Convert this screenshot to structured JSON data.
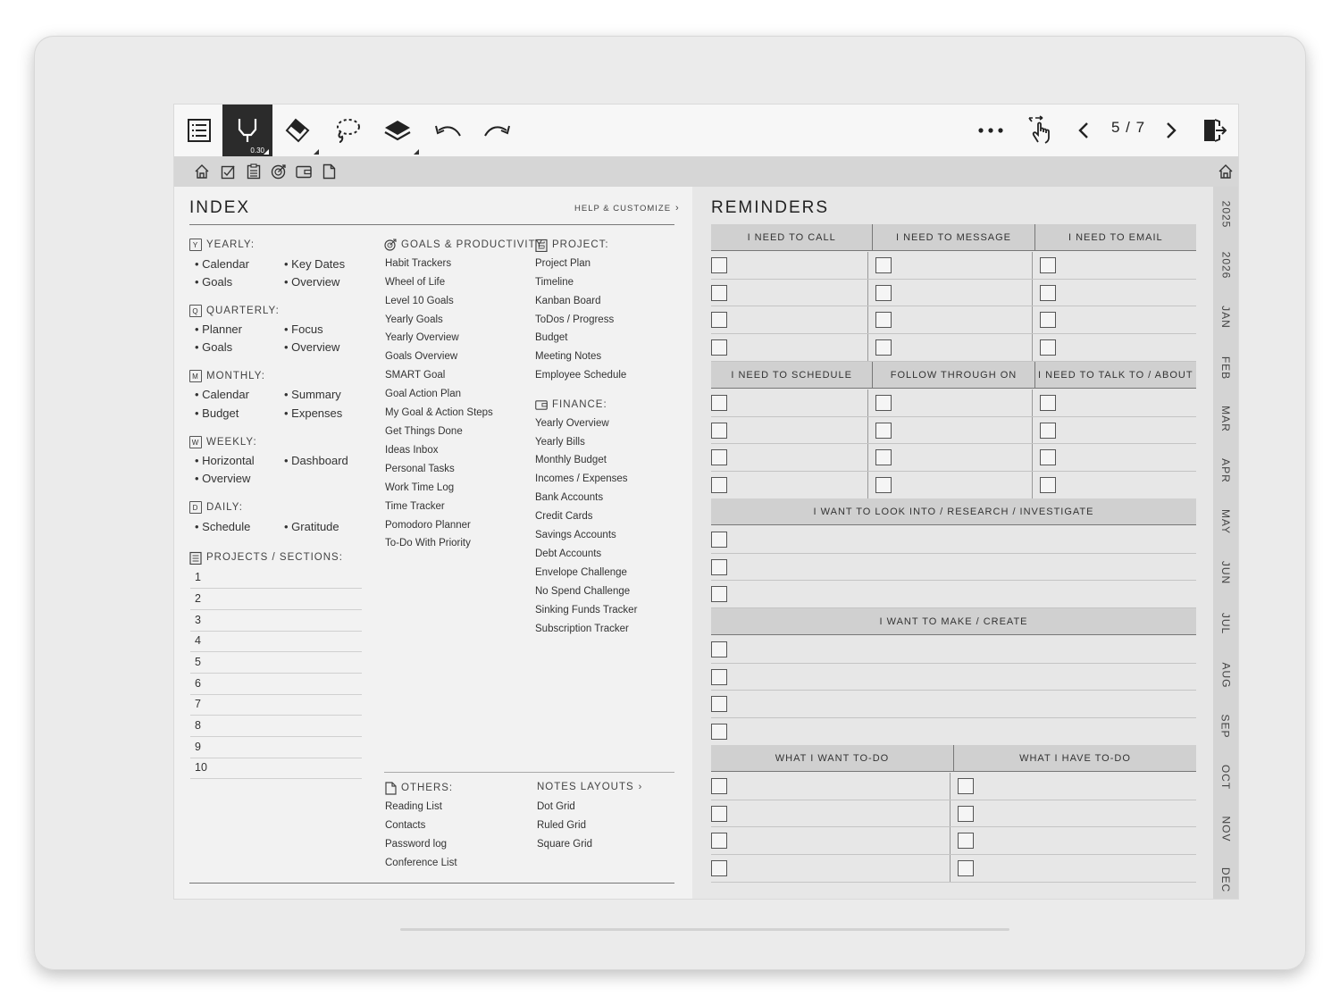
{
  "toolbar": {
    "pen_size": "0.30",
    "page_indicator": "5 / 7"
  },
  "index": {
    "title": "INDEX",
    "help_label": "HELP & CUSTOMIZE",
    "yearly": {
      "label": "YEARLY:",
      "icon_letter": "Y",
      "items": [
        "Calendar",
        "Goals",
        "Key Dates",
        "Overview"
      ]
    },
    "quarterly": {
      "label": "QUARTERLY:",
      "icon_letter": "Q",
      "items": [
        "Planner",
        "Goals",
        "Focus",
        "Overview"
      ]
    },
    "monthly": {
      "label": "MONTHLY:",
      "icon_letter": "M",
      "items": [
        "Calendar",
        "Budget",
        "Summary",
        "Expenses"
      ]
    },
    "weekly": {
      "label": "WEEKLY:",
      "icon_letter": "W",
      "items": [
        "Horizontal",
        "Overview",
        "Dashboard"
      ]
    },
    "daily": {
      "label": "DAILY:",
      "icon_letter": "D",
      "items": [
        "Schedule",
        "Gratitude"
      ]
    },
    "projects": {
      "label": "PROJECTS / SECTIONS:",
      "rows": [
        "1",
        "2",
        "3",
        "4",
        "5",
        "6",
        "7",
        "8",
        "9",
        "10"
      ]
    },
    "goals": {
      "label": "GOALS & PRODUCTIVITY:",
      "items": [
        "Habit Trackers",
        "Wheel of Life",
        "Level 10 Goals",
        "Yearly Goals",
        "Yearly Overview",
        "Goals Overview",
        "SMART Goal",
        "Goal Action Plan",
        "My Goal & Action Steps",
        "Get Things Done",
        "Ideas Inbox",
        "Personal Tasks",
        "Work Time Log",
        "Time Tracker",
        "Pomodoro Planner",
        "To-Do With Priority"
      ]
    },
    "project": {
      "label": "PROJECT:",
      "items": [
        "Project Plan",
        "Timeline",
        "Kanban Board",
        "ToDos / Progress",
        "Budget",
        "Meeting Notes",
        "Employee Schedule"
      ]
    },
    "finance": {
      "label": "FINANCE:",
      "items": [
        "Yearly Overview",
        "Yearly Bills",
        "Monthly Budget",
        "Incomes / Expenses",
        "Bank Accounts",
        "Credit Cards",
        "Savings Accounts",
        "Debt Accounts",
        "Envelope Challenge",
        "No Spend Challenge",
        "Sinking Funds Tracker",
        "Subscription Tracker"
      ]
    },
    "others": {
      "label": "OTHERS:",
      "items": [
        "Reading List",
        "Contacts",
        "Password log",
        "Conference List"
      ]
    },
    "notes_layouts": {
      "label": "NOTES LAYOUTS",
      "items": [
        "Dot Grid",
        "Ruled Grid",
        "Square Grid"
      ]
    }
  },
  "reminders": {
    "title": "REMINDERS",
    "section1": {
      "headers": [
        "I NEED TO CALL",
        "I NEED TO MESSAGE",
        "I NEED TO EMAIL"
      ],
      "rows": 4
    },
    "section2": {
      "headers": [
        "I NEED TO SCHEDULE",
        "FOLLOW THROUGH ON",
        "I NEED TO TALK TO / ABOUT"
      ],
      "rows": 4
    },
    "section3": {
      "headers": [
        "I WANT TO LOOK INTO / RESEARCH / INVESTIGATE"
      ],
      "rows": 3
    },
    "section4": {
      "headers": [
        "I WANT TO MAKE / CREATE"
      ],
      "rows": 4
    },
    "section5": {
      "headers": [
        "WHAT I WANT TO-DO",
        "WHAT I HAVE TO-DO"
      ],
      "rows": 4
    }
  },
  "side_tabs": [
    "2025",
    "2026",
    "JAN",
    "FEB",
    "MAR",
    "APR",
    "MAY",
    "JUN",
    "JUL",
    "AUG",
    "SEP",
    "OCT",
    "NOV",
    "DEC"
  ],
  "icons": {
    "toolbar": [
      "table-of-contents-icon",
      "pen-icon",
      "eraser-icon",
      "lasso-icon",
      "layers-icon",
      "undo-icon",
      "redo-icon",
      "more-icon",
      "gesture-icon",
      "prev-page-icon",
      "next-page-icon",
      "exit-icon"
    ],
    "subbar": [
      "home-icon",
      "checkbox-icon",
      "clipboard-icon",
      "target-icon",
      "wallet-icon",
      "document-icon"
    ]
  }
}
